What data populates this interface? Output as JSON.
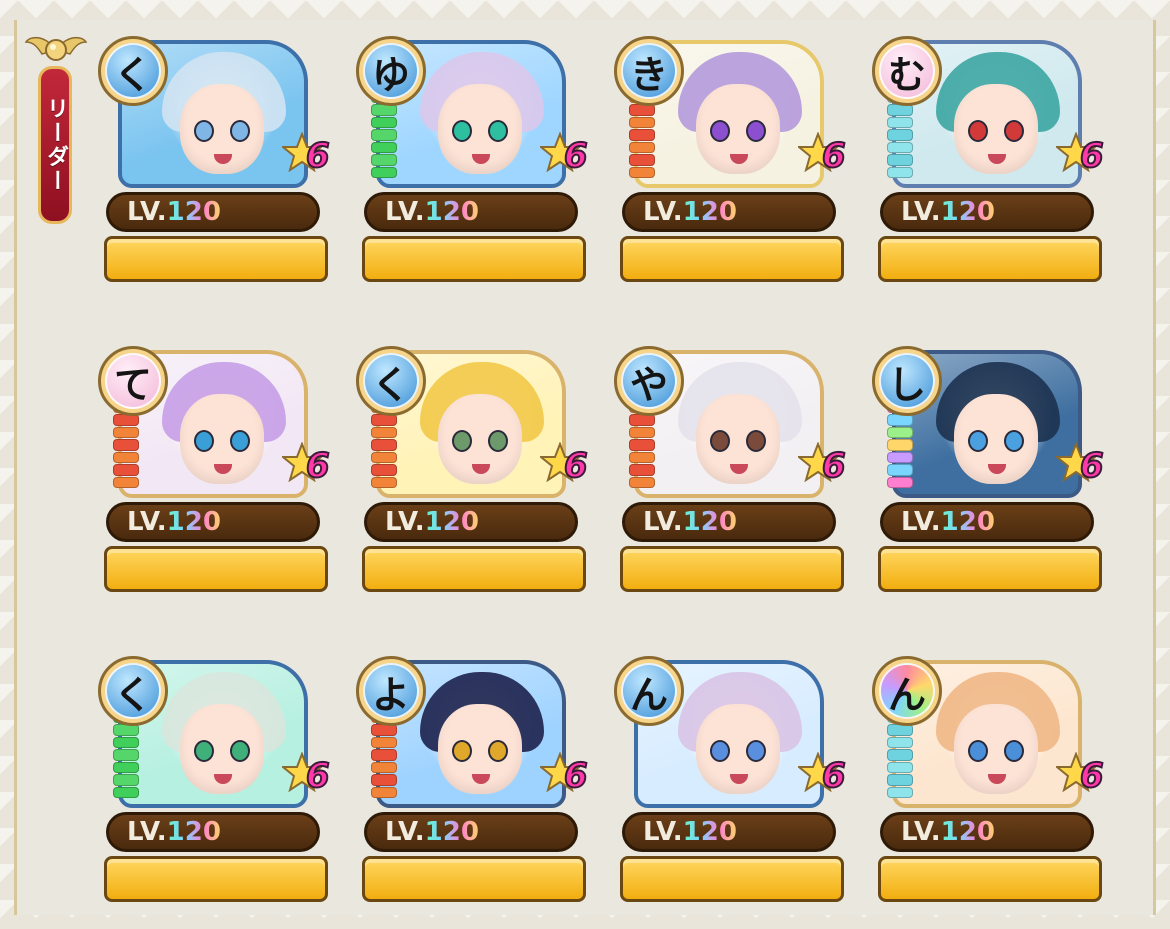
{
  "leader_label": "リーダー",
  "level_prefix": "LV.",
  "cards": [
    {
      "char": "く",
      "level": "120",
      "rank": "6",
      "bubble": "blue",
      "hair": "#cfe3f2",
      "eye": "#7fb6e6",
      "border": "#3d6fa8",
      "bg": "#7ac4f0",
      "gauge": "none"
    },
    {
      "char": "ゆ",
      "level": "120",
      "rank": "6",
      "bubble": "blue",
      "hair": "#d9c8ec",
      "eye": "#2dbf9f",
      "border": "#3d6fa8",
      "bg": "#9fd6ff",
      "gauge": "green"
    },
    {
      "char": "き",
      "level": "120",
      "rank": "6",
      "bubble": "blue",
      "hair": "#b59bdb",
      "eye": "#8b4fd0",
      "border": "#e7c86a",
      "bg": "#f6f2e2",
      "gauge": "red"
    },
    {
      "char": "む",
      "level": "120",
      "rank": "6",
      "bubble": "pink",
      "hair": "#3fa7a4",
      "eye": "#d23a3a",
      "border": "#5f7eb0",
      "bg": "#cfe9ee",
      "gauge": "cyan"
    },
    {
      "char": "て",
      "level": "120",
      "rank": "6",
      "bubble": "pink",
      "hair": "#c7a0e6",
      "eye": "#3a9fd6",
      "border": "#d9b36b",
      "bg": "#f2e8f5",
      "gauge": "red"
    },
    {
      "char": "く",
      "level": "120",
      "rank": "6",
      "bubble": "blue",
      "hair": "#f2c94a",
      "eye": "#6c9a6a",
      "border": "#d9b36b",
      "bg": "#fff3b8",
      "gauge": "red"
    },
    {
      "char": "や",
      "level": "120",
      "rank": "6",
      "bubble": "blue",
      "hair": "#e4e2ea",
      "eye": "#7a4a3a",
      "border": "#d9b36b",
      "bg": "#f3f0f3",
      "gauge": "red"
    },
    {
      "char": "し",
      "level": "120",
      "rank": "6",
      "bubble": "blue",
      "hair": "#1d3350",
      "eye": "#4ba0e0",
      "border": "#3d5a86",
      "bg": "#3e6fa0",
      "gauge": "rainbow"
    },
    {
      "char": "く",
      "level": "120",
      "rank": "6",
      "bubble": "blue",
      "hair": "#d8e6dc",
      "eye": "#3fb07a",
      "border": "#3d6fa8",
      "bg": "#b6f0e0",
      "gauge": "green"
    },
    {
      "char": "よ",
      "level": "120",
      "rank": "6",
      "bubble": "blue",
      "hair": "#1e2550",
      "eye": "#e0a82a",
      "border": "#3d5a86",
      "bg": "#9fd3ff",
      "gauge": "red"
    },
    {
      "char": "ん",
      "level": "120",
      "rank": "6",
      "bubble": "blue",
      "hair": "#d9c4e6",
      "eye": "#5a8fe0",
      "border": "#3d6fa8",
      "bg": "#d7ecff",
      "gauge": "none"
    },
    {
      "char": "ん",
      "level": "120",
      "rank": "6",
      "bubble": "rainbow",
      "hair": "#f0b888",
      "eye": "#4a8fd8",
      "border": "#d9b36b",
      "bg": "#fde6cf",
      "gauge": "cyan"
    }
  ]
}
